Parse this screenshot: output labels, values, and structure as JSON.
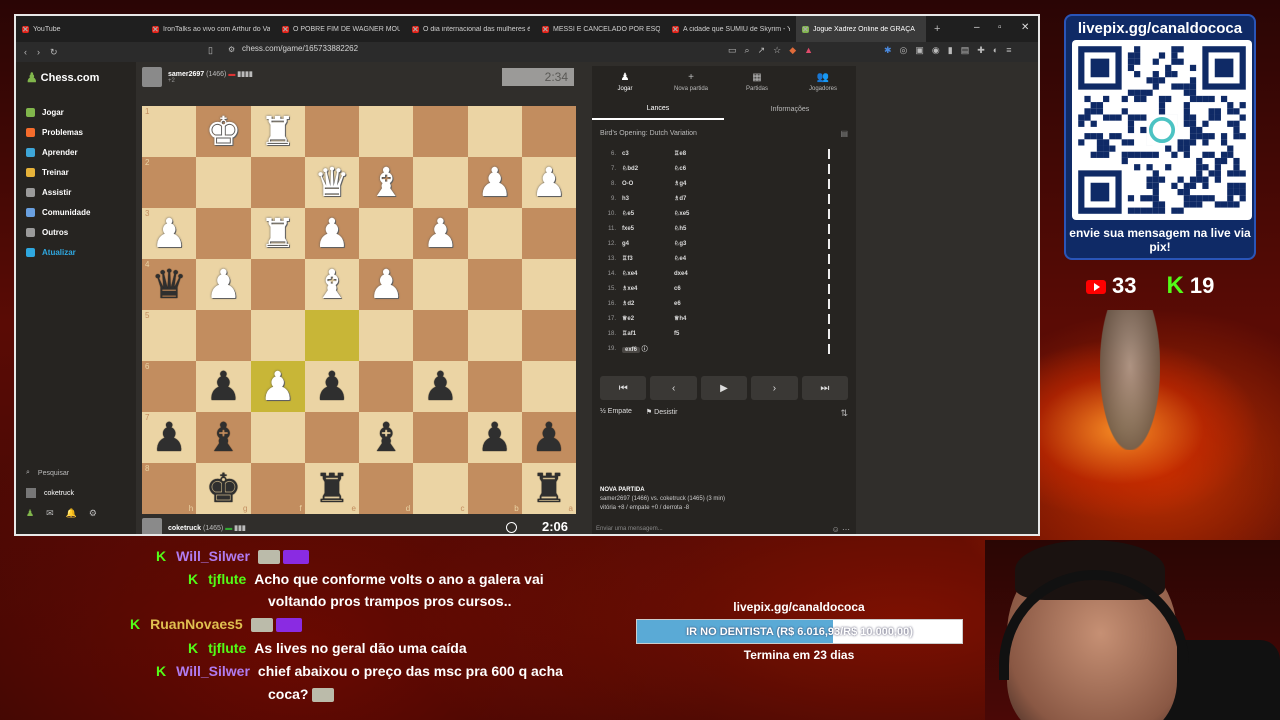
{
  "browser": {
    "tabs": [
      {
        "title": "YouTube",
        "active": false
      },
      {
        "title": "IronTalks ao vivo com Arthur do Val",
        "active": false
      },
      {
        "title": "O POBRE FIM DE WAGNER MOURA",
        "active": false
      },
      {
        "title": "O dia internacional das mulheres é o",
        "active": false
      },
      {
        "title": "MESSI É CANCELADO POR ESQUER",
        "active": false
      },
      {
        "title": "A cidade que SUMIU de Skyrim - Yo",
        "active": false
      },
      {
        "title": "Jogue Xadrez Online de GRAÇA",
        "active": true
      }
    ],
    "new_tab": "+",
    "url": "chess.com/game/165733882262"
  },
  "sidebar": {
    "logo": "Chess.com",
    "items": [
      {
        "label": "Jogar",
        "color": "#81b64c"
      },
      {
        "label": "Problemas",
        "color": "#f56c2c"
      },
      {
        "label": "Aprender",
        "color": "#3ea6d8"
      },
      {
        "label": "Treinar",
        "color": "#e7b33a"
      },
      {
        "label": "Assistir",
        "color": "#9b9b9b"
      },
      {
        "label": "Comunidade",
        "color": "#6aa0e0"
      },
      {
        "label": "Outros",
        "color": "#9b9b9b"
      },
      {
        "label": "Atualizar",
        "color": "#2fa8e0"
      }
    ],
    "search": "Pesquisar",
    "user": "coketruck"
  },
  "game": {
    "top_player": {
      "name": "samer2697",
      "rating": "(1466)",
      "extra": "+2"
    },
    "top_clock": "2:34",
    "bottom_player": {
      "name": "coketruck",
      "rating": "(1465)"
    },
    "bottom_clock": "2:06",
    "ranks": [
      "1",
      "2",
      "3",
      "4",
      "5",
      "6",
      "7",
      "8"
    ],
    "files": [
      "h",
      "g",
      "f",
      "e",
      "d",
      "c",
      "b",
      "a"
    ],
    "board": [
      [
        "",
        "wK",
        "wR",
        "",
        "",
        "",
        "",
        ""
      ],
      [
        "",
        "",
        "",
        "wQ",
        "wB",
        "",
        "wP",
        "wP"
      ],
      [
        "wP",
        "",
        "wR",
        "wP",
        "",
        "wP",
        "",
        ""
      ],
      [
        "bQ",
        "wP",
        "",
        "wB",
        "wP",
        "",
        "",
        ""
      ],
      [
        "",
        "",
        "",
        "",
        "",
        "",
        "",
        ""
      ],
      [
        "",
        "bP",
        "wP",
        "bP",
        "",
        "bP",
        "",
        ""
      ],
      [
        "bP",
        "bB",
        "",
        "",
        "bB",
        "",
        "bP",
        "bP"
      ],
      [
        "",
        "bK",
        "",
        "bR",
        "",
        "",
        "",
        "bR"
      ]
    ],
    "highlights": [
      [
        4,
        3
      ],
      [
        5,
        2
      ]
    ]
  },
  "panel": {
    "tabs": [
      {
        "label": "Jogar",
        "icon": "♟"
      },
      {
        "label": "Nova partida",
        "icon": "+"
      },
      {
        "label": "Partidas",
        "icon": "▦"
      },
      {
        "label": "Jogadores",
        "icon": "👥"
      }
    ],
    "subtabs": [
      "Lances",
      "Informações"
    ],
    "opening": "Bird's Opening: Dutch Variation",
    "moves": [
      {
        "n": "6.",
        "w": "c3",
        "b": "♖e8"
      },
      {
        "n": "7.",
        "w": "♘bd2",
        "b": "♘c6"
      },
      {
        "n": "8.",
        "w": "O-O",
        "b": "♗g4"
      },
      {
        "n": "9.",
        "w": "h3",
        "b": "♗d7"
      },
      {
        "n": "10.",
        "w": "♘e5",
        "b": "♘xe5"
      },
      {
        "n": "11.",
        "w": "fxe5",
        "b": "♘h5"
      },
      {
        "n": "12.",
        "w": "g4",
        "b": "♘g3"
      },
      {
        "n": "13.",
        "w": "♖f3",
        "b": "♘e4"
      },
      {
        "n": "14.",
        "w": "♘xe4",
        "b": "dxe4"
      },
      {
        "n": "15.",
        "w": "♗xe4",
        "b": "c6"
      },
      {
        "n": "16.",
        "w": "♗d2",
        "b": "e6"
      },
      {
        "n": "17.",
        "w": "♕e2",
        "b": "♕h4"
      },
      {
        "n": "18.",
        "w": "♖af1",
        "b": "f5"
      },
      {
        "n": "19.",
        "w": "exf6",
        "b": ""
      }
    ],
    "nav": [
      "⏮",
      "‹",
      "▶",
      "›",
      "⏭"
    ],
    "draw": "Empate",
    "resign": "Desistir",
    "new_game_title": "NOVA PARTIDA",
    "new_game_line1": "samer2697 (1466) vs. coketruck (1465) (3 min)",
    "new_game_line2": "vitória +8 / empate +0 / derrota -8",
    "chat_placeholder": "Enviar uma mensagem..."
  },
  "overlay": {
    "pix_title": "livepix.gg/canaldococa",
    "pix_msg": "envie sua mensagem na live via pix!",
    "youtube_count": "33",
    "kick_count": "19"
  },
  "chat": [
    {
      "user": "Will_Silwer",
      "color": "#b07cf0",
      "text": ""
    },
    {
      "user": "tjflute",
      "color": "#53fc18",
      "text": "Acho que conforme volts o ano a galera vai"
    },
    {
      "user": "",
      "color": "#fff",
      "text": "voltando pros trampos pros cursos.."
    },
    {
      "user": "RuanNovaes5",
      "color": "#e0c050",
      "text": ""
    },
    {
      "user": "tjflute",
      "color": "#53fc18",
      "text": "As lives no geral dão uma caída"
    },
    {
      "user": "Will_Silwer",
      "color": "#b07cf0",
      "text": "chief abaixou o preço das msc pra 600 q acha"
    },
    {
      "user": "",
      "color": "#fff",
      "text": "coca?"
    }
  ],
  "goal": {
    "url": "livepix.gg/canaldococa",
    "text": "IR NO DENTISTA (R$ 6.016,93/R$ 10.000,00)",
    "progress": 0.6017,
    "ends": "Termina em 23 dias"
  }
}
